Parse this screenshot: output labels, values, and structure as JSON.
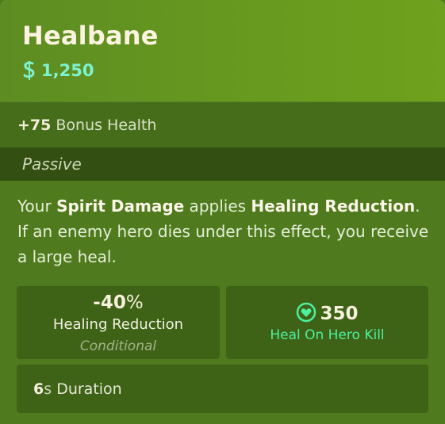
{
  "item": {
    "name": "Healbane",
    "cost": "1,250",
    "accent_color": "#7ef2cf"
  },
  "bonus": {
    "value": "+75",
    "label": "Bonus Health"
  },
  "passive": {
    "label": "Passive"
  },
  "description": {
    "part1": "Your ",
    "bold1": "Spirit Damage",
    "part2": " applies ",
    "bold2": "Healing Reduction",
    "part3": ". If an enemy hero dies under this effect, you receive a large heal."
  },
  "stats": {
    "healing_reduction": {
      "value": "-40",
      "unit": "%",
      "label": "Healing Reduction",
      "qualifier": "Conditional"
    },
    "heal_on_kill": {
      "value": "350",
      "label": "Heal On Hero Kill",
      "icon": "heal-heart-icon",
      "color": "#4cf0a0"
    },
    "duration": {
      "value": "6",
      "unit": "s",
      "label": "Duration"
    }
  }
}
